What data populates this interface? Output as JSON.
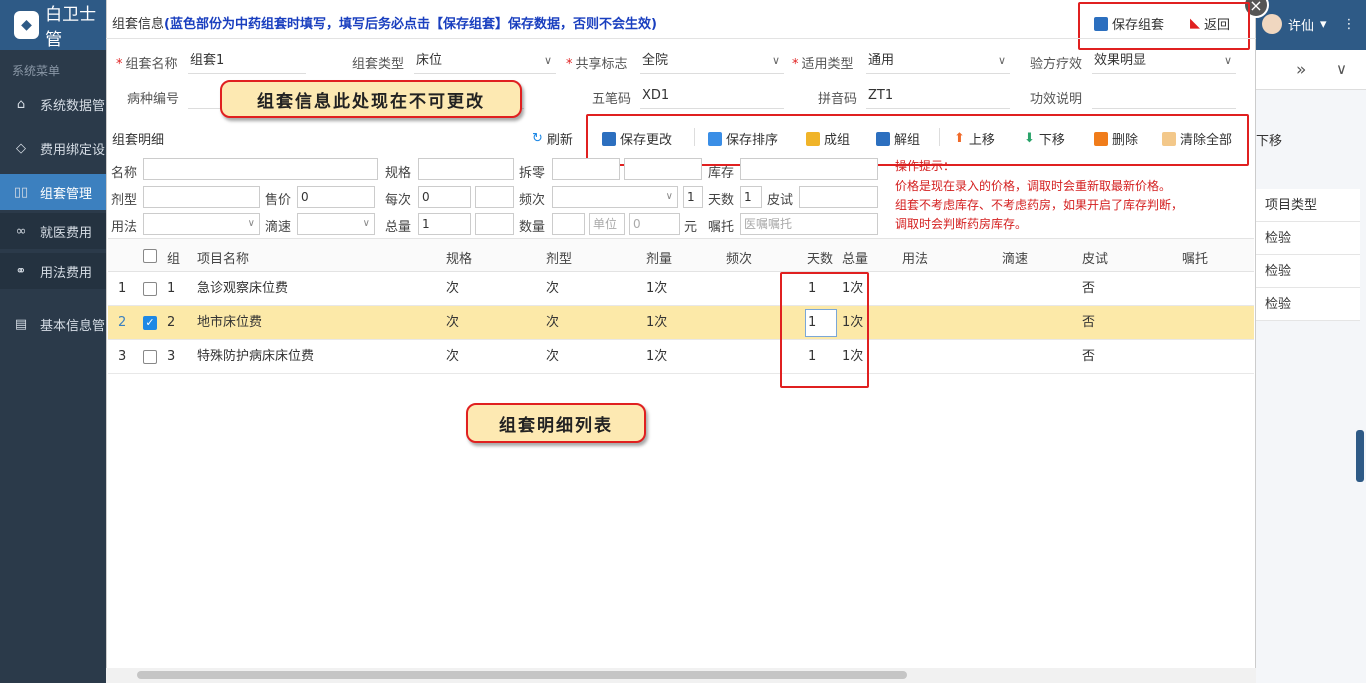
{
  "app": {
    "title": "白卫士管",
    "logo": "logo-icon"
  },
  "sidebar": {
    "caption": "系统菜单",
    "items": [
      {
        "label": "系统数据管",
        "icon": "home-icon"
      },
      {
        "label": "费用绑定设",
        "icon": "diamond-icon"
      },
      {
        "label": "组套管理",
        "icon": "grid-icon"
      },
      {
        "label": "就医费用",
        "icon": "infinity-icon"
      },
      {
        "label": "用法费用",
        "icon": "link-icon"
      },
      {
        "label": "基本信息管",
        "icon": "doc-icon"
      }
    ]
  },
  "user": {
    "name": "许仙"
  },
  "right_pane": {
    "nav_prev": "»",
    "nav_down": "∨",
    "partial_text": "下移",
    "header": "项目类型",
    "cells": [
      "检验",
      "检验",
      "检验"
    ]
  },
  "dialog": {
    "title_prefix": "组套信息",
    "title_hint": "(蓝色部份为中药组套时填写，填写后务必点击【保存组套】保存数据，否则不会生效)",
    "save_set": "保存组套",
    "back": "返回",
    "close": "×"
  },
  "form": {
    "name_label": "组套名称",
    "name_value": "组套1",
    "type_label": "组套类型",
    "type_value": "床位",
    "share_label": "共享标志",
    "share_value": "全院",
    "apply_label": "适用类型",
    "apply_value": "通用",
    "effect_label": "验方疗效",
    "effect_value": "效果明显",
    "disease_label": "病种编号",
    "wubi_label": "五笔码",
    "wubi_value": "XD1",
    "pinyin_label": "拼音码",
    "pinyin_value": "ZT1",
    "func_label": "功效说明"
  },
  "callouts": {
    "info": "组套信息此处现在不可更改",
    "list": "组套明细列表"
  },
  "detail": {
    "title": "组套明细",
    "refresh": "刷新",
    "toolbar": [
      "保存更改",
      "保存排序",
      "成组",
      "解组",
      "上移",
      "下移",
      "删除",
      "清除全部"
    ]
  },
  "editor": {
    "name_label": "名称",
    "spec_label": "规格",
    "split_label": "拆零",
    "stock_label": "库存",
    "form_label": "剂型",
    "price_label": "售价",
    "price_value": "0",
    "per_label": "每次",
    "per_value": "0",
    "freq_label": "频次",
    "freq_num": "1",
    "days_label": "天数",
    "days_value": "1",
    "skin_label": "皮试",
    "usage_label": "用法",
    "drip_label": "滴速",
    "total_label": "总量",
    "total_value": "1",
    "qty_label": "数量",
    "unit_placeholder": "单位",
    "unit_value": "0",
    "yuan": "元",
    "advice_label": "嘱托",
    "advice_placeholder": "医嘱嘱托"
  },
  "tips": {
    "title": "操作提示：",
    "line1": "价格是现在录入的价格，调取时会重新取最新价格。",
    "line2": "组套不考虑库存、不考虑药房，如果开启了库存判断，",
    "line3": "调取时会判断药房库存。"
  },
  "table": {
    "headers": {
      "group": "组",
      "name": "项目名称",
      "spec": "规格",
      "form": "剂型",
      "dose": "剂量",
      "freq": "频次",
      "days": "天数",
      "total": "总量",
      "usage": "用法",
      "drip": "滴速",
      "skin": "皮试",
      "advice": "嘱托"
    },
    "rows": [
      {
        "no": "1",
        "group": "1",
        "name": "急诊观察床位费",
        "spec": "次",
        "form": "次",
        "dose": "1次",
        "days": "1",
        "total": "1次",
        "skin": "否",
        "checked": false
      },
      {
        "no": "2",
        "group": "2",
        "name": "地市床位费",
        "spec": "次",
        "form": "次",
        "dose": "1次",
        "days": "1",
        "total": "1次",
        "skin": "否",
        "checked": true
      },
      {
        "no": "3",
        "group": "3",
        "name": "特殊防护病床床位费",
        "spec": "次",
        "form": "次",
        "dose": "1次",
        "days": "1",
        "total": "1次",
        "skin": "否",
        "checked": false
      }
    ]
  }
}
